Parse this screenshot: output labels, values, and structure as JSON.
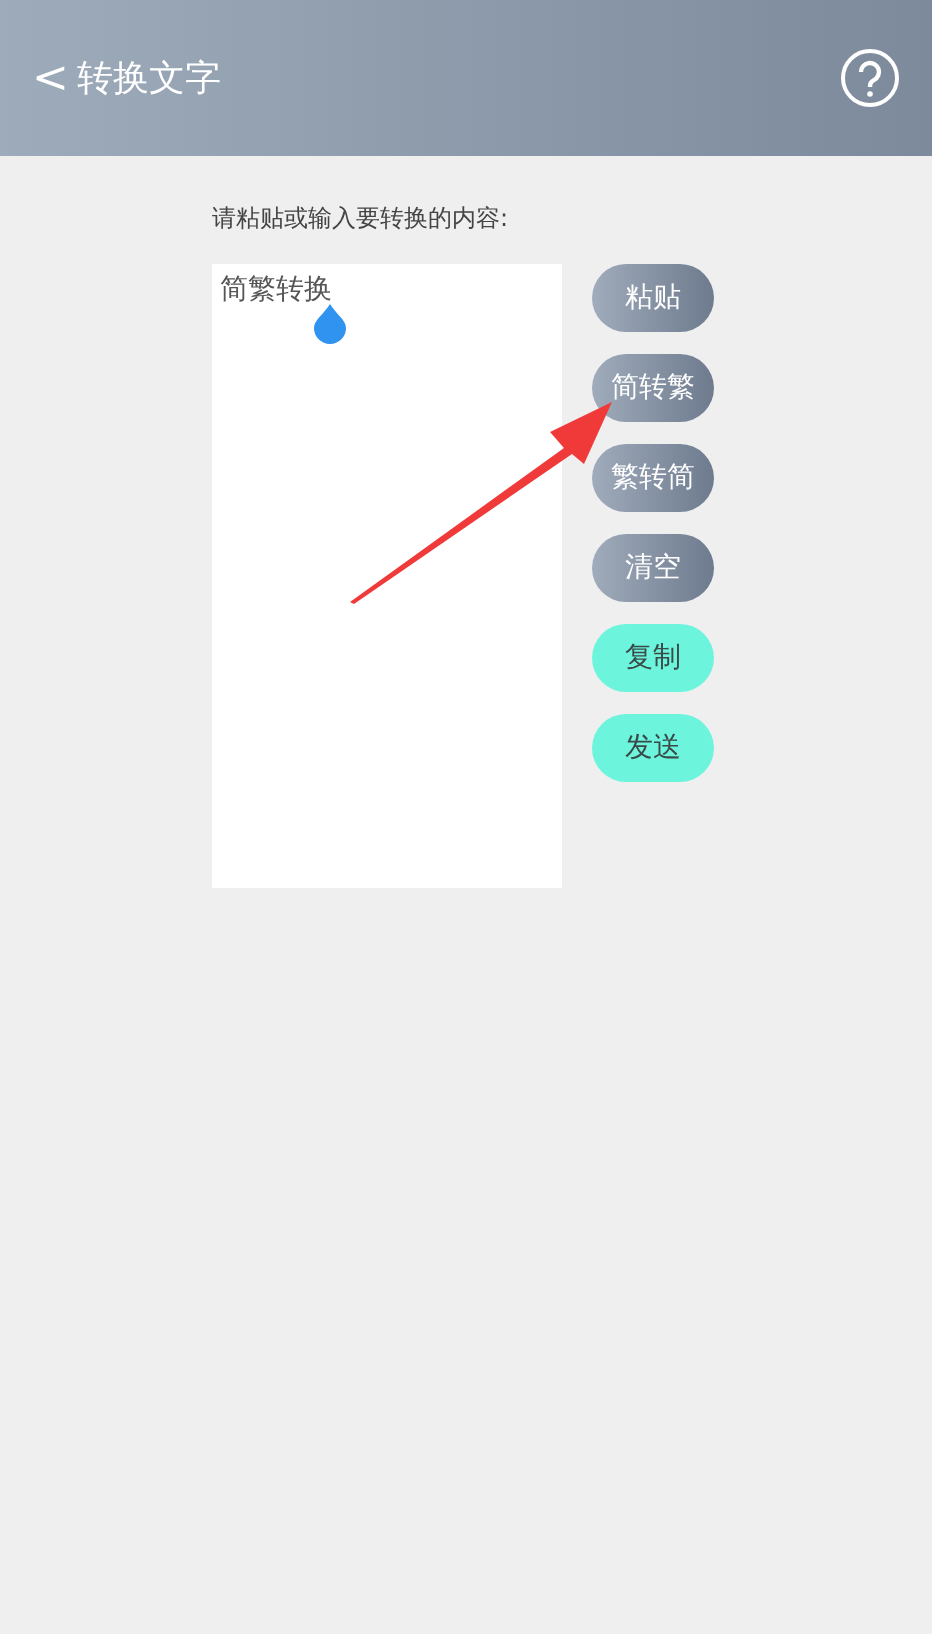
{
  "header": {
    "back": "<",
    "title": "转换文字"
  },
  "prompt": "请粘贴或输入要转换的内容:",
  "editor": {
    "value": "简繁转换"
  },
  "buttons": [
    {
      "label": "粘贴",
      "kind": "gray"
    },
    {
      "label": "简转繁",
      "kind": "gray"
    },
    {
      "label": "繁转简",
      "kind": "gray"
    },
    {
      "label": "清空",
      "kind": "gray"
    },
    {
      "label": "复制",
      "kind": "teal"
    },
    {
      "label": "发送",
      "kind": "teal"
    }
  ]
}
